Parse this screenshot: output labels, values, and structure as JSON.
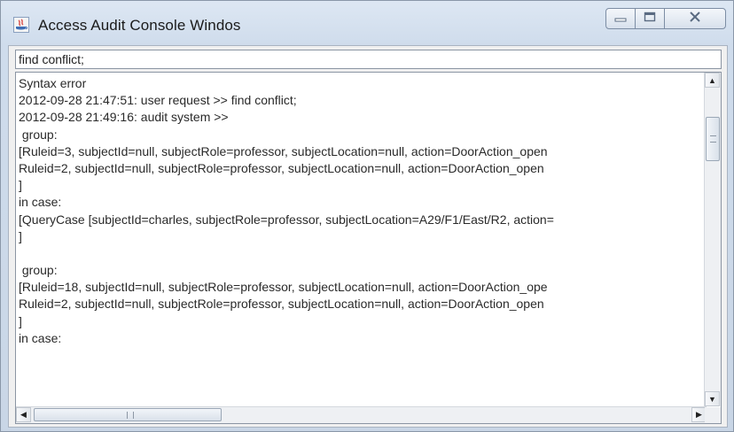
{
  "window": {
    "title": "Access Audit Console Windos"
  },
  "command": {
    "value": "find conflict;"
  },
  "output": {
    "lines": [
      "Syntax error",
      "2012-09-28 21:47:51: user request >> find conflict;",
      "2012-09-28 21:49:16: audit system >>",
      " group:",
      "[Ruleid=3, subjectId=null, subjectRole=professor, subjectLocation=null, action=DoorAction_open",
      "Ruleid=2, subjectId=null, subjectRole=professor, subjectLocation=null, action=DoorAction_open",
      "]",
      "in case:",
      "[QueryCase [subjectId=charles, subjectRole=professor, subjectLocation=A29/F1/East/R2, action=",
      "]",
      "",
      " group:",
      "[Ruleid=18, subjectId=null, subjectRole=professor, subjectLocation=null, action=DoorAction_ope",
      "Ruleid=2, subjectId=null, subjectRole=professor, subjectLocation=null, action=DoorAction_open",
      "]",
      "in case:"
    ]
  },
  "icons": {
    "app": "java-app-icon",
    "minimize": "minimize-icon",
    "maximize": "maximize-icon",
    "close": "close-icon",
    "scroll_up": "arrow-up-icon",
    "scroll_down": "arrow-down-icon",
    "scroll_left": "arrow-left-icon",
    "scroll_right": "arrow-right-icon"
  },
  "colors": {
    "title_bar": "#cfdcec",
    "text": "#2a2a2a"
  }
}
